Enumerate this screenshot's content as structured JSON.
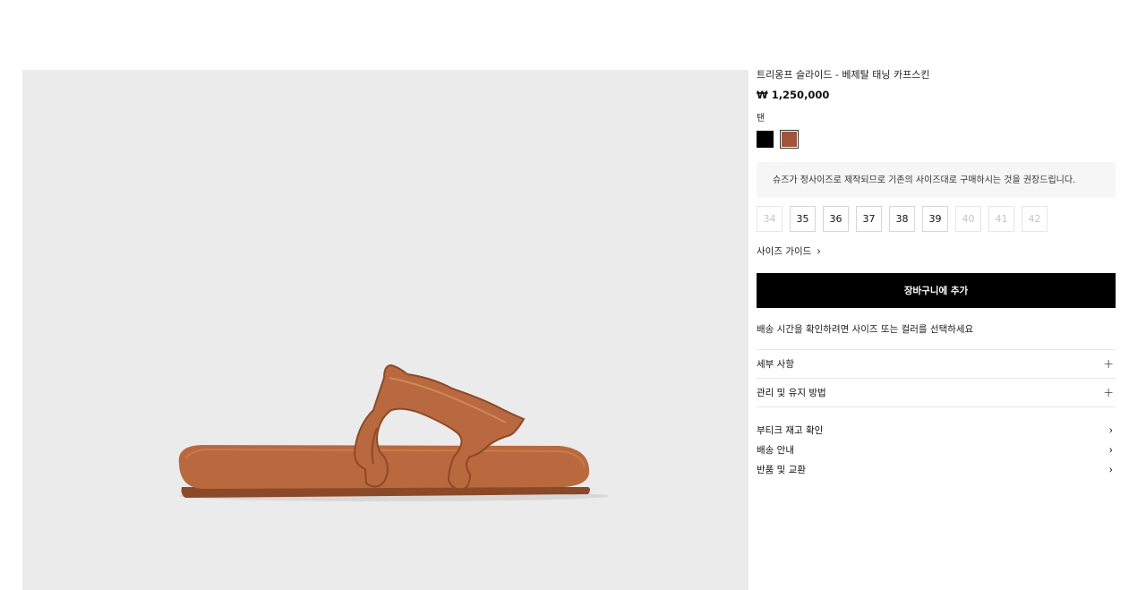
{
  "product": {
    "title": "트리옹프 슬라이드 - 베제탈 태닝 카프스킨",
    "price": "₩ 1,250,000",
    "image_alt": "slide-sandal-photo"
  },
  "color": {
    "selected_label": "탠",
    "swatches": [
      {
        "name": "black",
        "hex": "#000000"
      },
      {
        "name": "tan",
        "hex": "#a0543a"
      }
    ]
  },
  "notice": "슈즈가 정사이즈로 제작되므로 기존의 사이즈대로 구매하시는 것을 권장드립니다.",
  "sizes": [
    {
      "label": "34",
      "available": false
    },
    {
      "label": "35",
      "available": true
    },
    {
      "label": "36",
      "available": true
    },
    {
      "label": "37",
      "available": true
    },
    {
      "label": "38",
      "available": true
    },
    {
      "label": "39",
      "available": true
    },
    {
      "label": "40",
      "available": false
    },
    {
      "label": "41",
      "available": false
    },
    {
      "label": "42",
      "available": false
    }
  ],
  "size_guide": {
    "label": "사이즈 가이드",
    "icon": "chevron-right-icon"
  },
  "add_to_cart": "장바구니에 추가",
  "shipping_hint": "배송 시간을 확인하려면 사이즈 또는 컬러를 선택하세요",
  "accordion": [
    {
      "label": "세부 사항",
      "icon": "plus-icon"
    },
    {
      "label": "관리 및 유지 방법",
      "icon": "plus-icon"
    }
  ],
  "links": [
    {
      "label": "부티크 재고 확인",
      "icon": "chevron-right-icon"
    },
    {
      "label": "배송 안내",
      "icon": "chevron-right-icon"
    },
    {
      "label": "반품 및 교환",
      "icon": "chevron-right-icon"
    }
  ],
  "colors": {
    "image_bg": "#ebebeb",
    "button_bg": "#000000",
    "notice_bg": "#f6f6f6",
    "leather": "#b8693f"
  }
}
